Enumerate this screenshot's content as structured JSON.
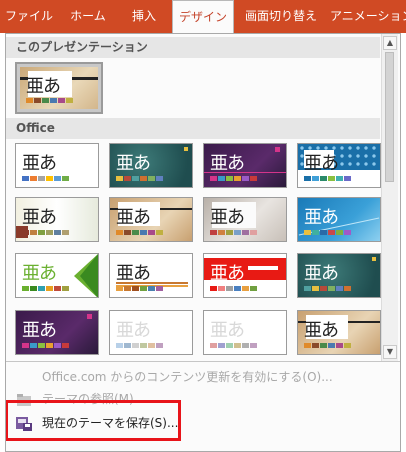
{
  "ribbon": {
    "tabs": [
      {
        "label": "ファイル"
      },
      {
        "label": "ホーム"
      },
      {
        "label": "挿入"
      },
      {
        "label": "デザイン"
      },
      {
        "label": "画面切り替え"
      },
      {
        "label": "アニメーション"
      }
    ],
    "active_tab": "デザイン"
  },
  "gallery": {
    "current_section": "このプレゼンテーション",
    "office_section": "Office",
    "sample_text": "亜あ"
  },
  "menu": {
    "update_label": "Office.com からのコンテンツ更新を有効にする(O)...",
    "browse_label": "テーマの参照(M)...",
    "save_label": "現在のテーマを保存(S)..."
  },
  "colors": {
    "ribbon": "#d04a24",
    "highlight": "#e8141a"
  }
}
